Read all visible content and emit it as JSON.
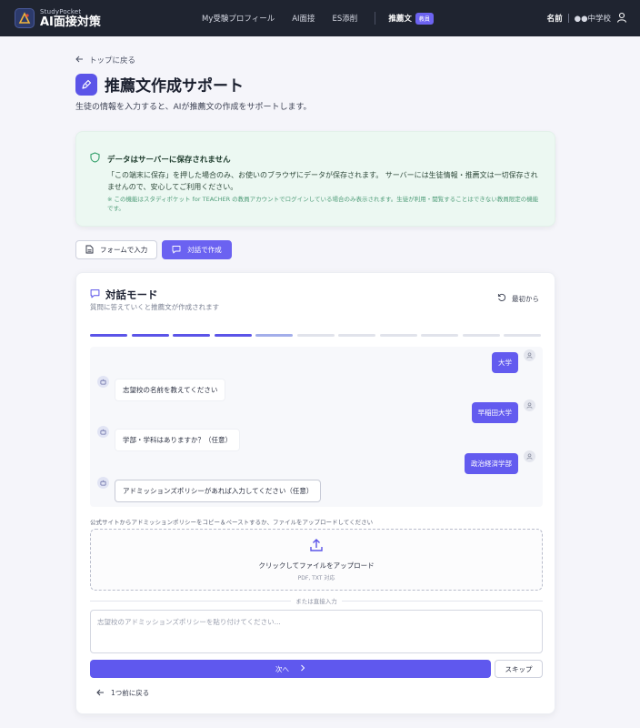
{
  "header": {
    "brand_sub": "StudyPocket",
    "brand_main": "AI面接対策",
    "nav": [
      "My受験プロフィール",
      "AI面接",
      "ES添削"
    ],
    "active_nav": "推薦文",
    "badge": "教員",
    "user_name": "名前",
    "school": "●●中学校"
  },
  "page": {
    "back": "トップに戻る",
    "title": "推薦文作成サポート",
    "description": "生徒の情報を入力すると、AIが推薦文の作成をサポートします。"
  },
  "notice": {
    "title": "データはサーバーに保存されません",
    "body": "「この端末に保存」を押した場合のみ、お使いのブラウザにデータが保存されます。 サーバーには生徒情報・推薦文は一切保存されませんので、安心してご利用ください。",
    "small": "※ この機能はスタディポケット for TEACHER の教員アカウントでログインしている場合のみ表示されます。生徒が利用・閲覧することはできない教員限定の機能です。"
  },
  "mode_tabs": {
    "form": "フォームで入力",
    "chat": "対話で作成"
  },
  "chat_card": {
    "title": "対話モード",
    "subtitle": "質問に答えていくと推薦文が作成されます",
    "restart": "最初から",
    "progress": {
      "total": 11,
      "done": 4,
      "current": 5
    },
    "messages": [
      {
        "role": "user",
        "text": "大学"
      },
      {
        "role": "bot",
        "text": "志望校の名前を教えてください"
      },
      {
        "role": "user",
        "text": "早稲田大学"
      },
      {
        "role": "bot",
        "text": "学部・学科はありますか？（任意）"
      },
      {
        "role": "user",
        "text": "政治経済学部"
      },
      {
        "role": "bot",
        "text": "アドミッションズポリシーがあれば入力してください（任意）"
      }
    ],
    "upload_label": "公式サイトからアドミッションポリシーをコピー＆ペーストするか、ファイルをアップロードしてください",
    "upload_title": "クリックしてファイルをアップロード",
    "upload_sub": "PDF, TXT 対応",
    "or_text": "または直接入力",
    "input_placeholder": "志望校のアドミッションズポリシーを貼り付けてください...",
    "next": "次へ",
    "skip": "スキップ",
    "prev": "1つ前に戻る"
  },
  "colors": {
    "accent": "#5f58ee",
    "header_bg": "#1f2430",
    "notice_bg": "#ecf8f2"
  }
}
